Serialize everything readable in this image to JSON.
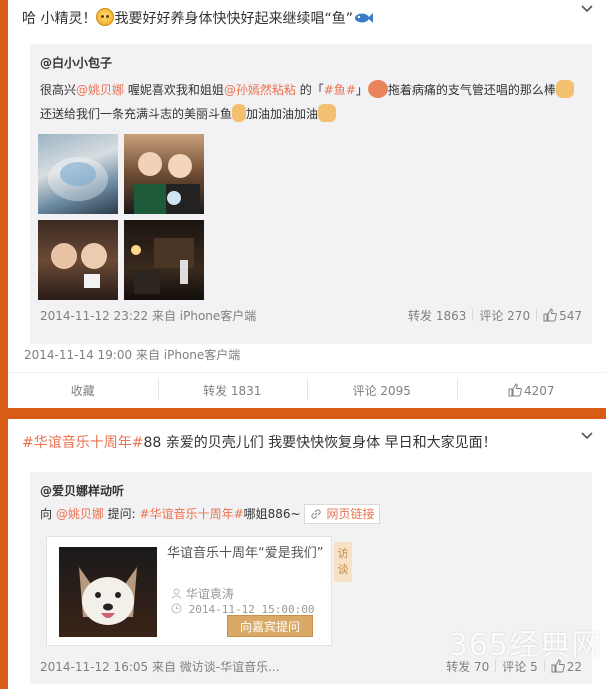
{
  "post1": {
    "text_prefix": "哈 小精灵！",
    "text_main": "我要好好养身体快快好起来继续唱“鱼”",
    "retweet": {
      "author": "@白小小包子",
      "line1_a": "很高兴",
      "mention1": "@姚贝娜",
      "line1_b": " 喔妮喜欢我和姐姐",
      "mention2": "@孙嫣然粘粘",
      "line1_c": " 的「",
      "topic": "#鱼#",
      "line1_d": "」",
      "line1_e": "拖着病痛的支气管还唱的那么棒",
      "line2_a": "还送给我们一条充满斗志的美丽斗鱼",
      "line2_b": "加油加油加油",
      "meta": "2014-11-12 23:22 来自 iPhone客户端",
      "repost": "转发 1863",
      "comment": "评论 270",
      "like": "547"
    },
    "meta": "2014-11-14 19:00 来自 iPhone客户端",
    "actions": {
      "favorite": "收藏",
      "repost": "转发 1831",
      "comment": "评论 2095",
      "like": "4207"
    }
  },
  "post2": {
    "topic": "#华谊音乐十周年#",
    "text": "88 亲爱的贝壳儿们 我要快快恢复身体 早日和大家见面！",
    "retweet": {
      "author": "@爱贝娜样动听",
      "line_a": "向 ",
      "mention": "@姚贝娜",
      "line_b": " 提问: ",
      "topic": "#华谊音乐十周年#",
      "line_c": "哪姐886~",
      "web_link": "网页链接",
      "card": {
        "title": "华谊音乐十周年“爱是我们”",
        "host": "华谊袁涛",
        "time": "2014-11-12 15:00:00",
        "ask_button": "向嘉宾提问",
        "side_tag": "访谈"
      },
      "meta": "2014-11-12 16:05 来自 微访谈-华谊音乐...",
      "repost": "转发 70",
      "comment": "评论 5",
      "like": "22"
    }
  },
  "watermark": "365经典网",
  "colors": {
    "page_bg": "#d95c16",
    "link": "#eb7350",
    "retweet_bg": "#f2f2f5"
  }
}
